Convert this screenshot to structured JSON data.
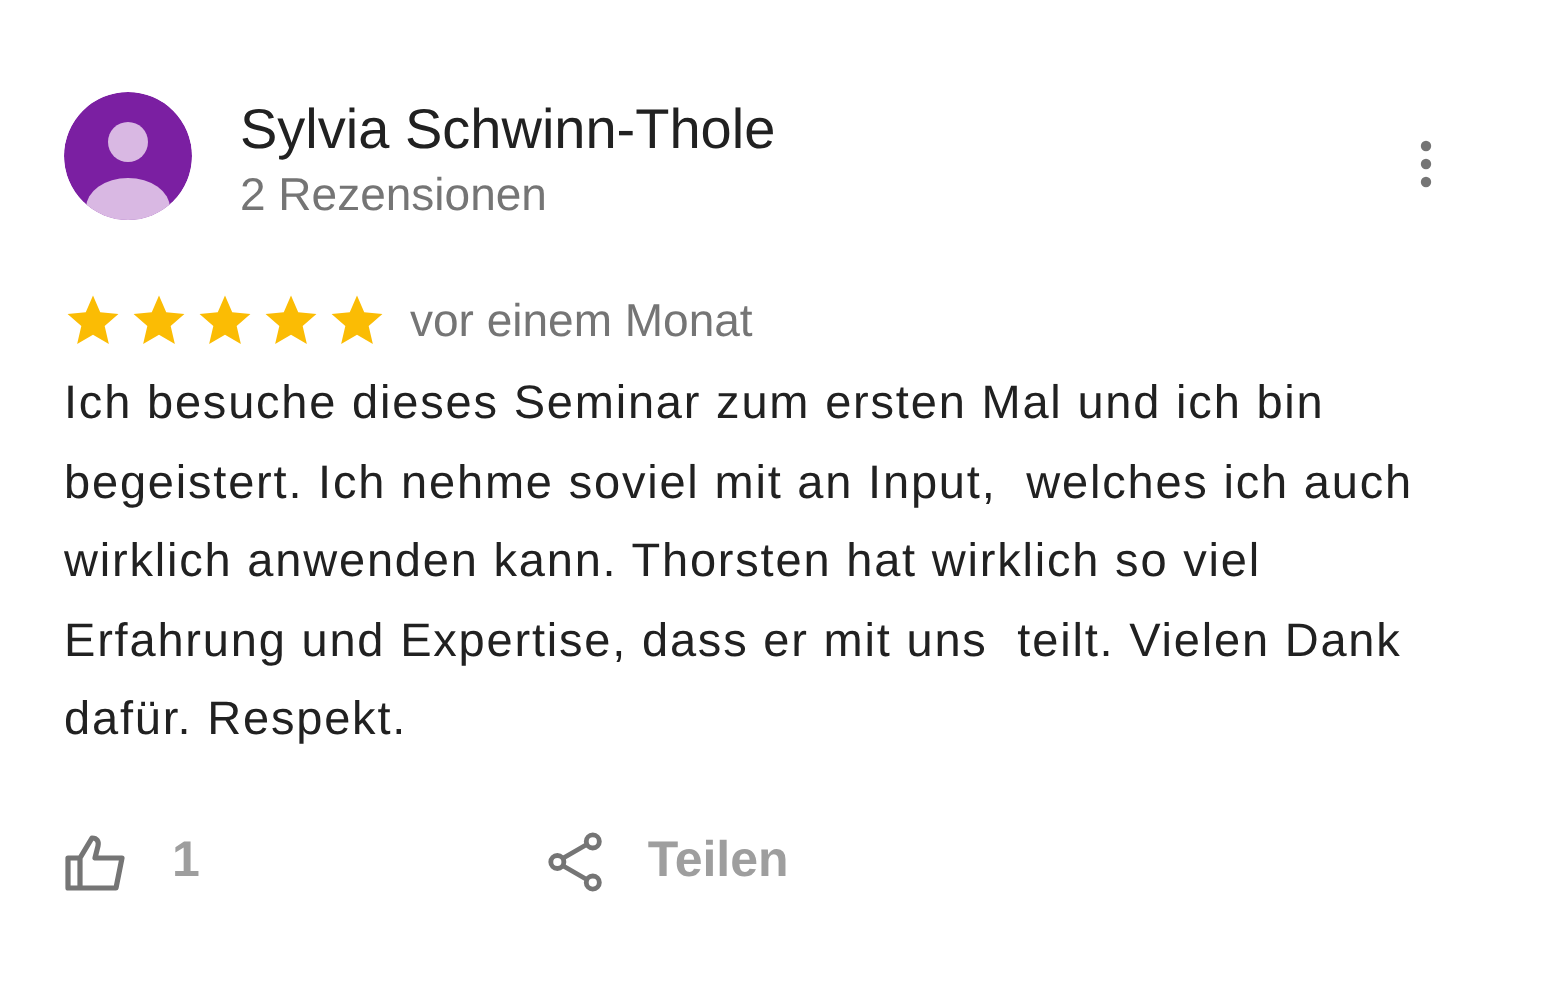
{
  "reviewer": {
    "name": "Sylvia Schwinn-Thole",
    "reviews": "2 Rezensionen"
  },
  "review": {
    "stars": 5,
    "time": "vor einem Monat",
    "text": "Ich besuche dieses Seminar zum ersten Mal und ich bin begeistert. Ich nehme soviel mit an Input,  welches ich auch wirklich anwenden kann. Thorsten hat wirklich so viel Erfahrung und Expertise, dass er mit uns  teilt. Vielen Dank dafür. Respekt."
  },
  "actions": {
    "likes": "1",
    "share": "Teilen"
  }
}
